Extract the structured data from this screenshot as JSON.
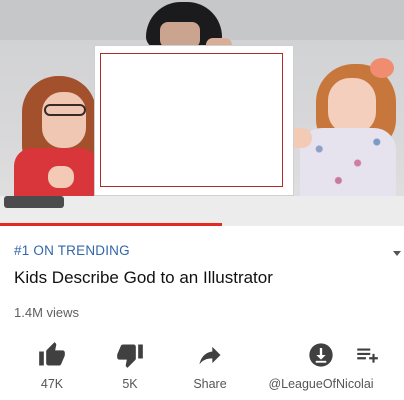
{
  "video": {
    "progress": 0.55
  },
  "meta": {
    "trending_label": "#1 ON TRENDING",
    "title": "Kids Describe God to an Illustrator",
    "views": "1.4M views"
  },
  "actions": [
    {
      "icon": "thumbs-up-icon",
      "label": "47K"
    },
    {
      "icon": "thumbs-down-icon",
      "label": "5K"
    },
    {
      "icon": "share-icon",
      "label": "Share"
    },
    {
      "icon": "download-icon",
      "label": "@LeagueOfNicolai"
    },
    {
      "icon": "add-to-playlist-icon",
      "label": ""
    }
  ],
  "colors": {
    "trending": "#3266a8",
    "progress": "#e02a22",
    "icon": "#404040"
  }
}
